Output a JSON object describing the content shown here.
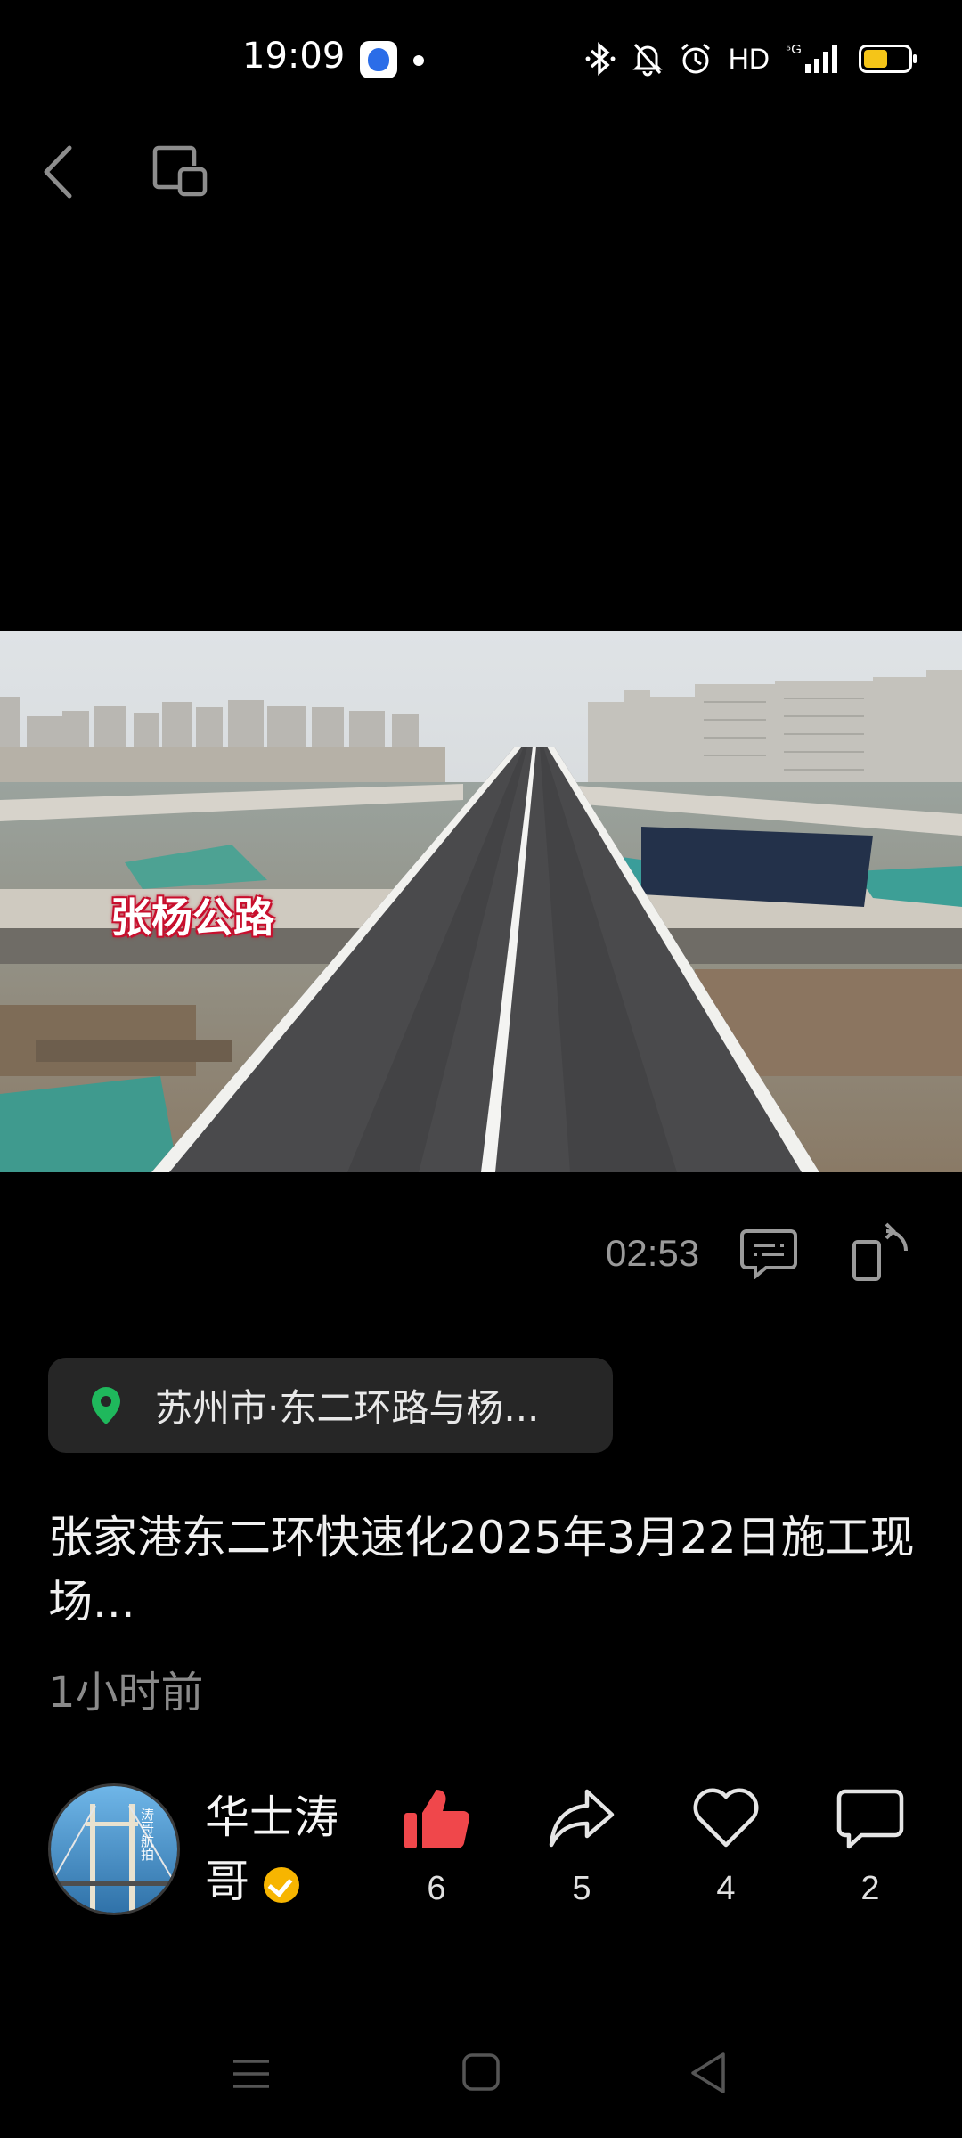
{
  "status_bar": {
    "time": "19:09",
    "network_label": "HD",
    "network_type": "5G",
    "battery_percent": 55,
    "icons": [
      "baidu-app-icon",
      "notification-dot",
      "bluetooth-icon",
      "mute-bell-icon",
      "alarm-icon",
      "signal-icon",
      "battery-icon"
    ]
  },
  "video": {
    "overlay_text": "张杨公路",
    "duration": "02:53"
  },
  "location": {
    "text": "苏州市·东二环路与杨..."
  },
  "post": {
    "caption": "张家港东二环快速化2025年3月22日施工现场...",
    "time_ago": "1小时前"
  },
  "author": {
    "name": "华士涛哥",
    "avatar_text": "涛哥航拍",
    "verified": true
  },
  "actions": {
    "likes": "6",
    "shares": "5",
    "favorites": "4",
    "comments": "2"
  },
  "colors": {
    "like_active": "#f0474b",
    "location_pin": "#1fb85c",
    "verified_badge": "#f7b500",
    "battery_fill": "#f5c518"
  }
}
